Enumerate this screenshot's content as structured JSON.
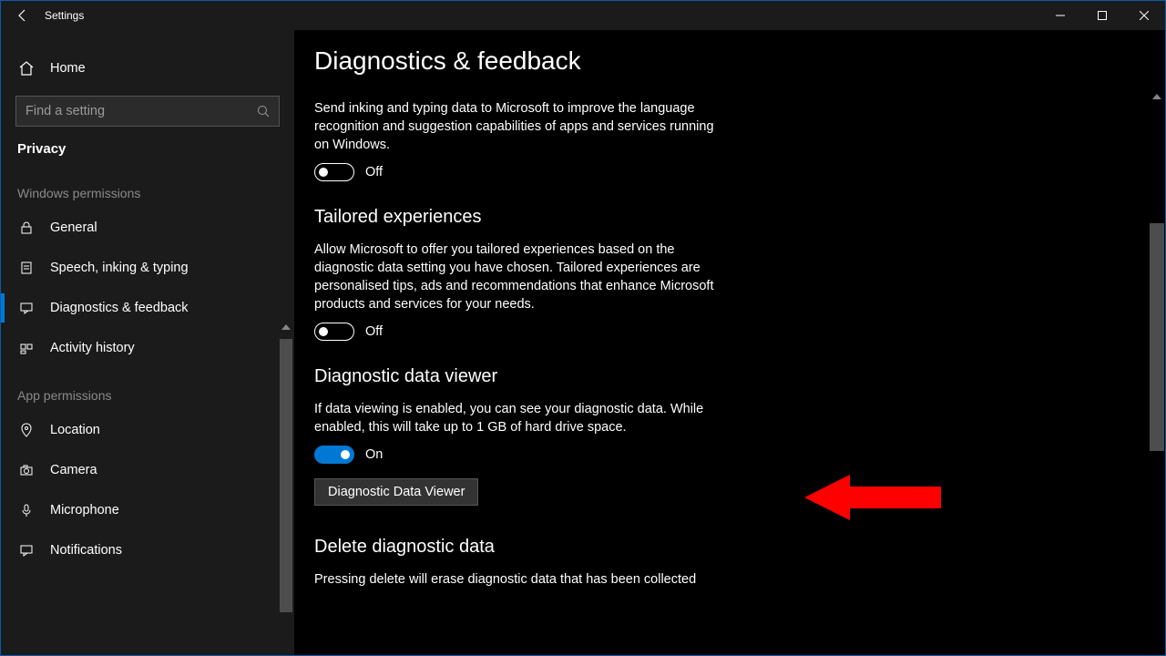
{
  "window": {
    "title": "Settings"
  },
  "sidebar": {
    "home": "Home",
    "search_placeholder": "Find a setting",
    "category": "Privacy",
    "group_windows": "Windows permissions",
    "group_app": "App permissions",
    "items_windows": [
      {
        "label": "General"
      },
      {
        "label": "Speech, inking & typing"
      },
      {
        "label": "Diagnostics & feedback"
      },
      {
        "label": "Activity history"
      }
    ],
    "items_app": [
      {
        "label": "Location"
      },
      {
        "label": "Camera"
      },
      {
        "label": "Microphone"
      },
      {
        "label": "Notifications"
      }
    ]
  },
  "main": {
    "title": "Diagnostics & feedback",
    "inking_desc": "Send inking and typing data to Microsoft to improve the language recognition and suggestion capabilities of apps and services running on Windows.",
    "inking_state": "Off",
    "tailored_heading": "Tailored experiences",
    "tailored_desc": "Allow Microsoft to offer you tailored experiences based on the diagnostic data setting you have chosen. Tailored experiences are personalised tips, ads and recommendations that enhance Microsoft products and services for your needs.",
    "tailored_state": "Off",
    "viewer_heading": "Diagnostic data viewer",
    "viewer_desc": "If data viewing is enabled, you can see your diagnostic data. While enabled, this will take up to 1 GB of hard drive space.",
    "viewer_state": "On",
    "viewer_button": "Diagnostic Data Viewer",
    "delete_heading": "Delete diagnostic data",
    "delete_desc": "Pressing delete will erase diagnostic data that has been collected"
  }
}
